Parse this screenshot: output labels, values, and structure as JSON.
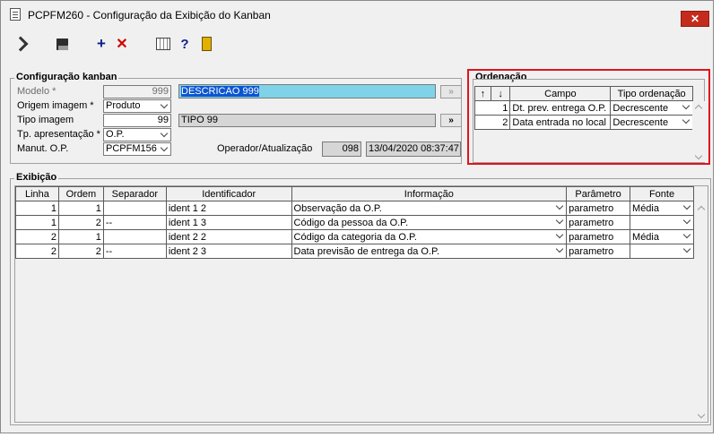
{
  "window": {
    "title": "PCPFM260 - Configuração da Exibição do Kanban",
    "close_label": "✕"
  },
  "toolbar": {
    "icons": [
      "navigate-icon",
      "save-icon",
      "add-icon",
      "delete-icon",
      "grid-icon",
      "help-icon",
      "exit-icon"
    ],
    "add_glyph": "+",
    "delete_glyph": "✕",
    "help_glyph": "?"
  },
  "kanban": {
    "title": "Configuração kanban",
    "modelo_label": "Modelo *",
    "modelo_value": "999",
    "modelo_desc": "DESCRICAO 999",
    "origem_label": "Origem imagem *",
    "origem_value": "Produto",
    "tipo_label": "Tipo imagem",
    "tipo_value": "99",
    "tipo_desc": "TIPO 99",
    "tp_apres_label": "Tp. apresentação *",
    "tp_apres_value": "O.P.",
    "manut_label": "Manut. O.P.",
    "manut_value": "PCPFM156",
    "operador_label": "Operador/Atualização",
    "operador_value": "098",
    "atualizacao_value": "13/04/2020 08:37:47",
    "lookup_btn": "»"
  },
  "ordenacao": {
    "title": "Ordenação",
    "headers": {
      "up": "↑",
      "down": "↓",
      "campo": "Campo",
      "tipo": "Tipo ordenação"
    },
    "rows": [
      {
        "n": "1",
        "campo": "Dt. prev. entrega O.P.",
        "tipo": "Decrescente"
      },
      {
        "n": "2",
        "campo": "Data entrada no local",
        "tipo": "Decrescente"
      }
    ]
  },
  "exibicao": {
    "title": "Exibição",
    "headers": [
      "Linha",
      "Ordem",
      "Separador",
      "Identificador",
      "Informação",
      "Parâmetro",
      "Fonte"
    ],
    "rows": [
      {
        "linha": "1",
        "ordem": "1",
        "separador": "",
        "identificador": "ident 1 2",
        "informacao": "Observação da O.P.",
        "parametro": "parametro",
        "fonte": "Média"
      },
      {
        "linha": "1",
        "ordem": "2",
        "separador": "--",
        "identificador": "ident 1 3",
        "informacao": "Código da pessoa da O.P.",
        "parametro": "parametro",
        "fonte": ""
      },
      {
        "linha": "2",
        "ordem": "1",
        "separador": "",
        "identificador": "ident 2 2",
        "informacao": "Código da categoria da O.P.",
        "parametro": "parametro",
        "fonte": "Média"
      },
      {
        "linha": "2",
        "ordem": "2",
        "separador": "--",
        "identificador": "ident 2 3",
        "informacao": "Data previsão de entrega da O.P.",
        "parametro": "parametro",
        "fonte": ""
      }
    ]
  },
  "colors": {
    "highlight_border": "#e0141e",
    "selection_bg": "#0a56d1",
    "field_highlight": "#7fd3e8",
    "close_button": "#c42b1c"
  }
}
